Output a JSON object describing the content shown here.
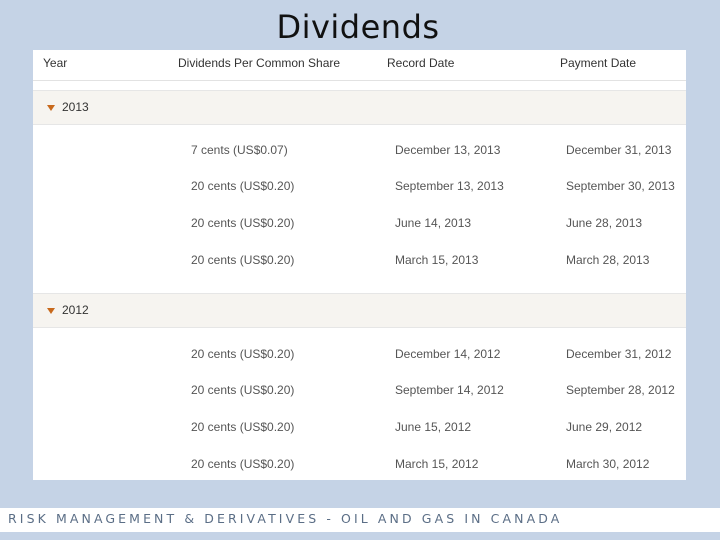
{
  "slide": {
    "title": "Dividends"
  },
  "table": {
    "headers": {
      "year": "Year",
      "dividend": "Dividends Per Common Share",
      "record_date": "Record Date",
      "payment_date": "Payment Date"
    },
    "groups": [
      {
        "year": "2013",
        "rows": [
          {
            "dividend": "7 cents (US$0.07)",
            "record_date": "December 13, 2013",
            "payment_date": "December 31, 2013"
          },
          {
            "dividend": "20 cents (US$0.20)",
            "record_date": "September 13, 2013",
            "payment_date": "September 30, 2013"
          },
          {
            "dividend": "20 cents (US$0.20)",
            "record_date": "June 14, 2013",
            "payment_date": "June 28, 2013"
          },
          {
            "dividend": "20 cents (US$0.20)",
            "record_date": "March 15, 2013",
            "payment_date": "March 28, 2013"
          }
        ]
      },
      {
        "year": "2012",
        "rows": [
          {
            "dividend": "20 cents (US$0.20)",
            "record_date": "December 14, 2012",
            "payment_date": "December 31, 2012"
          },
          {
            "dividend": "20 cents (US$0.20)",
            "record_date": "September 14, 2012",
            "payment_date": "September 28, 2012"
          },
          {
            "dividend": "20 cents (US$0.20)",
            "record_date": "June 15, 2012",
            "payment_date": "June 29, 2012"
          },
          {
            "dividend": "20 cents (US$0.20)",
            "record_date": "March 15, 2012",
            "payment_date": "March 30, 2012"
          }
        ]
      }
    ]
  },
  "footer": {
    "text": "RISK MANAGEMENT & DERIVATIVES - OIL AND GAS IN CANADA"
  },
  "colors": {
    "background": "#c5d3e6",
    "accent_triangle": "#c8691c",
    "group_row": "#f6f4f0"
  }
}
